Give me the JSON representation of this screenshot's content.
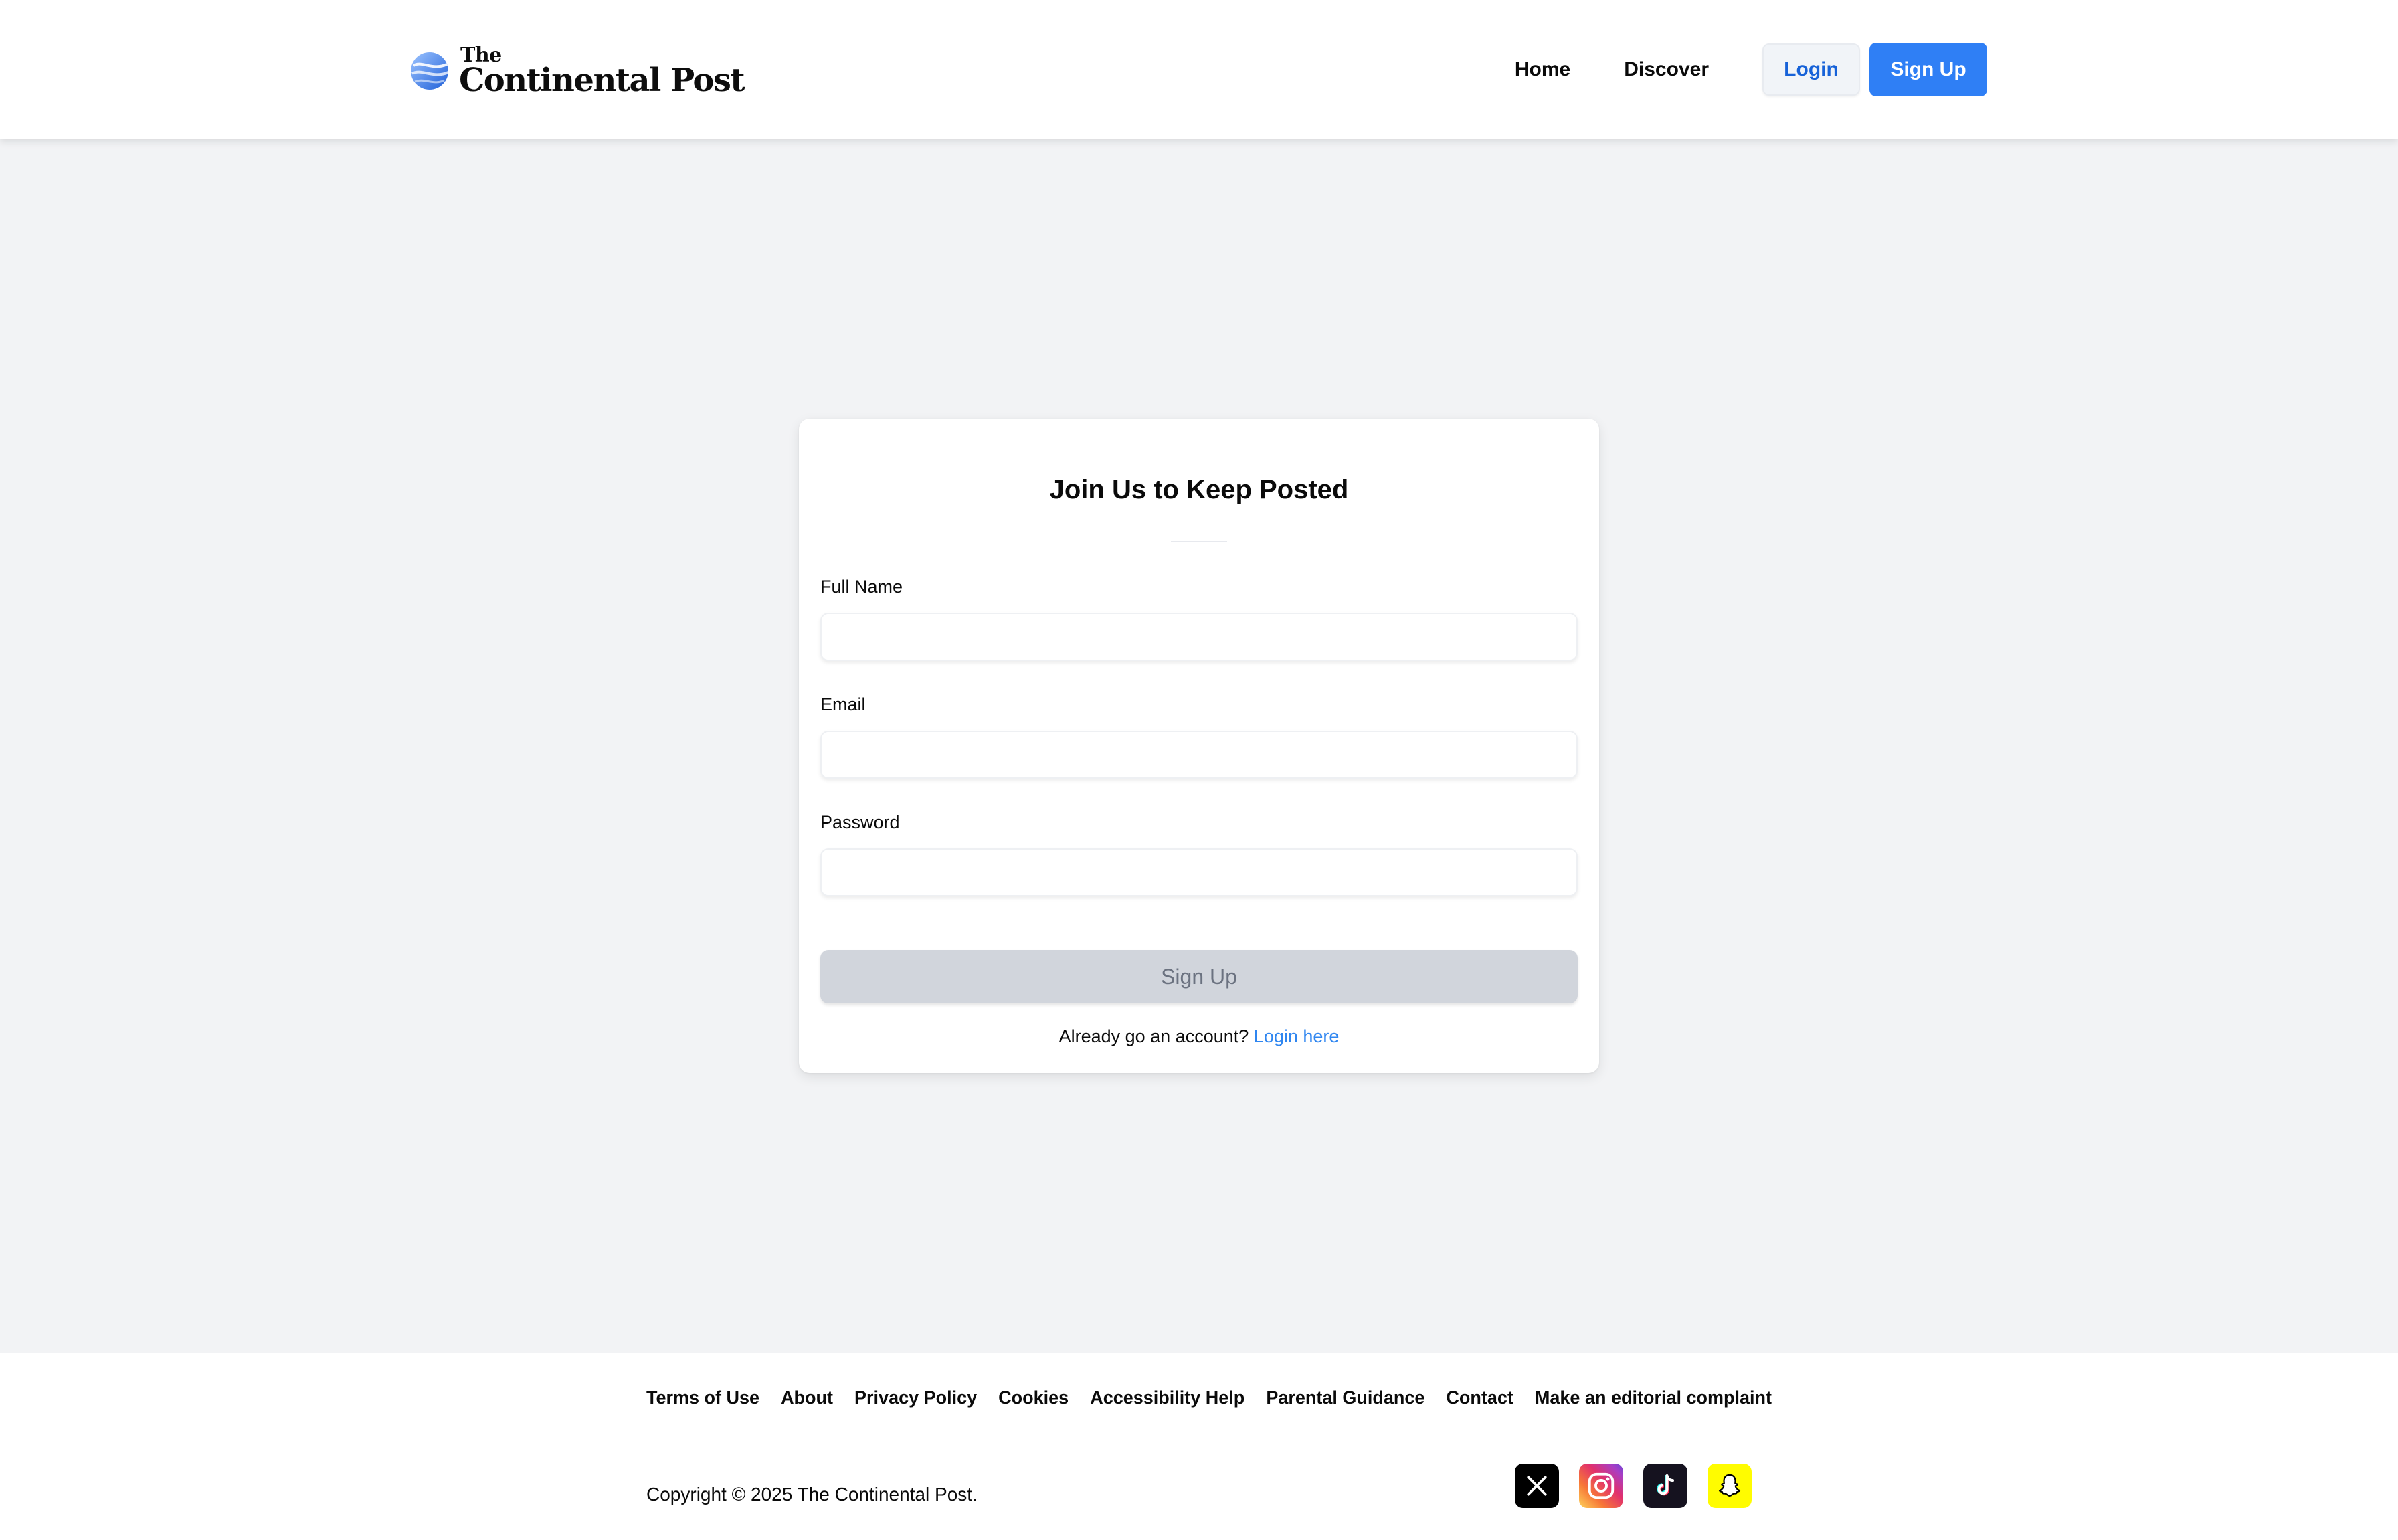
{
  "header": {
    "logo": {
      "the": "The",
      "name": "Continental Post"
    },
    "nav": {
      "home": "Home",
      "discover": "Discover"
    },
    "login_label": "Login",
    "signup_label": "Sign Up"
  },
  "form": {
    "title": "Join Us to Keep Posted",
    "full_name_label": "Full Name",
    "full_name_value": "",
    "email_label": "Email",
    "email_value": "",
    "password_label": "Password",
    "password_value": "",
    "submit_label": "Sign Up",
    "login_prompt": "Already go an account?",
    "login_link": "Login here"
  },
  "footer": {
    "links": [
      "Terms of Use",
      "About",
      "Privacy Policy",
      "Cookies",
      "Accessibility Help",
      "Parental Guidance",
      "Contact",
      "Make an editorial complaint"
    ],
    "copyright": "Copyright © 2025 The Continental Post.",
    "socials": [
      "x-icon",
      "instagram-icon",
      "tiktok-icon",
      "snapchat-icon"
    ]
  },
  "colors": {
    "accent": "#2f7ff5",
    "link": "#2f86f0",
    "page_bg": "#f2f3f5",
    "disabled_button": "#d1d5dc"
  }
}
